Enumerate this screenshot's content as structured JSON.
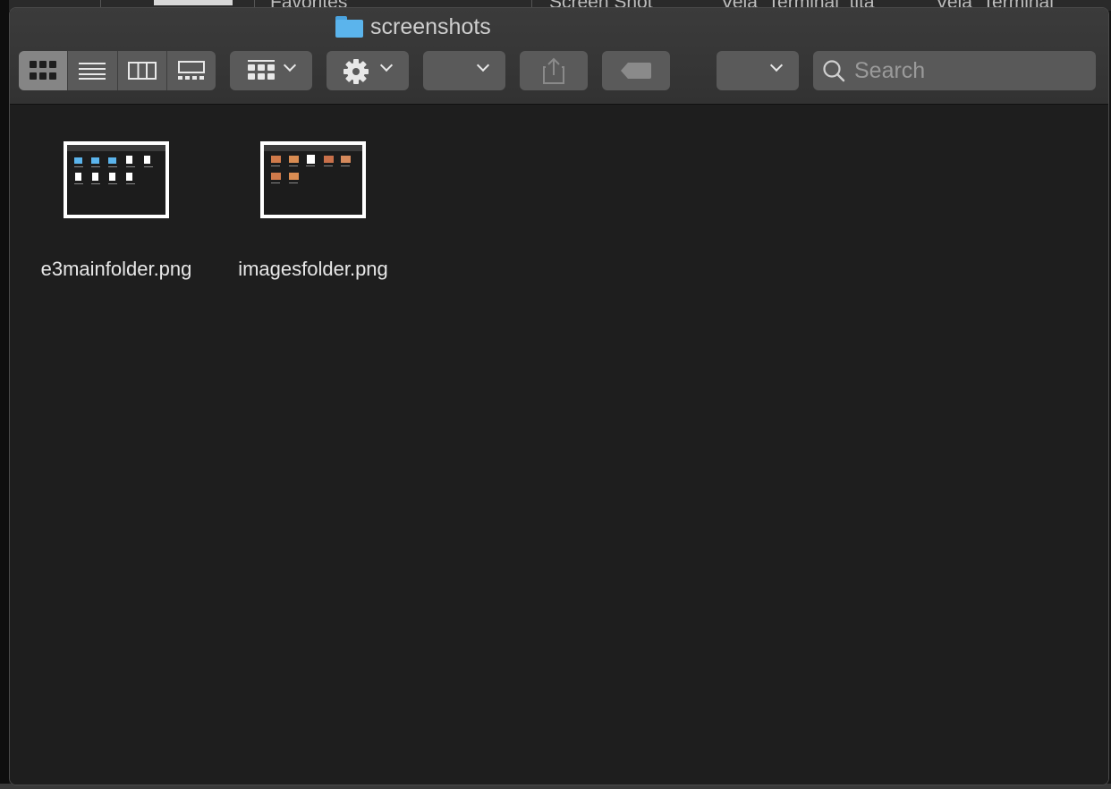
{
  "background": {
    "sidebar_heading": "Favorites",
    "file_labels": [
      "Screen Shot",
      "Vela_Terminal_tita",
      "Vela_Terminal"
    ]
  },
  "window": {
    "title": "screenshots",
    "folder_icon": "folder-icon"
  },
  "toolbar": {
    "view_modes": [
      {
        "name": "icon-view",
        "icon": "grid-icon",
        "active": true
      },
      {
        "name": "list-view",
        "icon": "list-icon",
        "active": false
      },
      {
        "name": "column-view",
        "icon": "columns-icon",
        "active": false
      },
      {
        "name": "gallery-view",
        "icon": "gallery-icon",
        "active": false
      }
    ],
    "group_icon": "group-grid-icon",
    "action_icon": "gear-icon",
    "share_icon": "share-icon",
    "tag_icon": "tag-icon",
    "search": {
      "placeholder": "Search",
      "value": ""
    }
  },
  "files": [
    {
      "name": "e3mainfolder.png"
    },
    {
      "name": "imagesfolder.png"
    }
  ],
  "colors": {
    "folder_blue": "#5bb4ec",
    "window_bg": "#1e1e1e",
    "toolbar_bg": "#3b3b3b",
    "button_bg": "#5a5a5a"
  }
}
